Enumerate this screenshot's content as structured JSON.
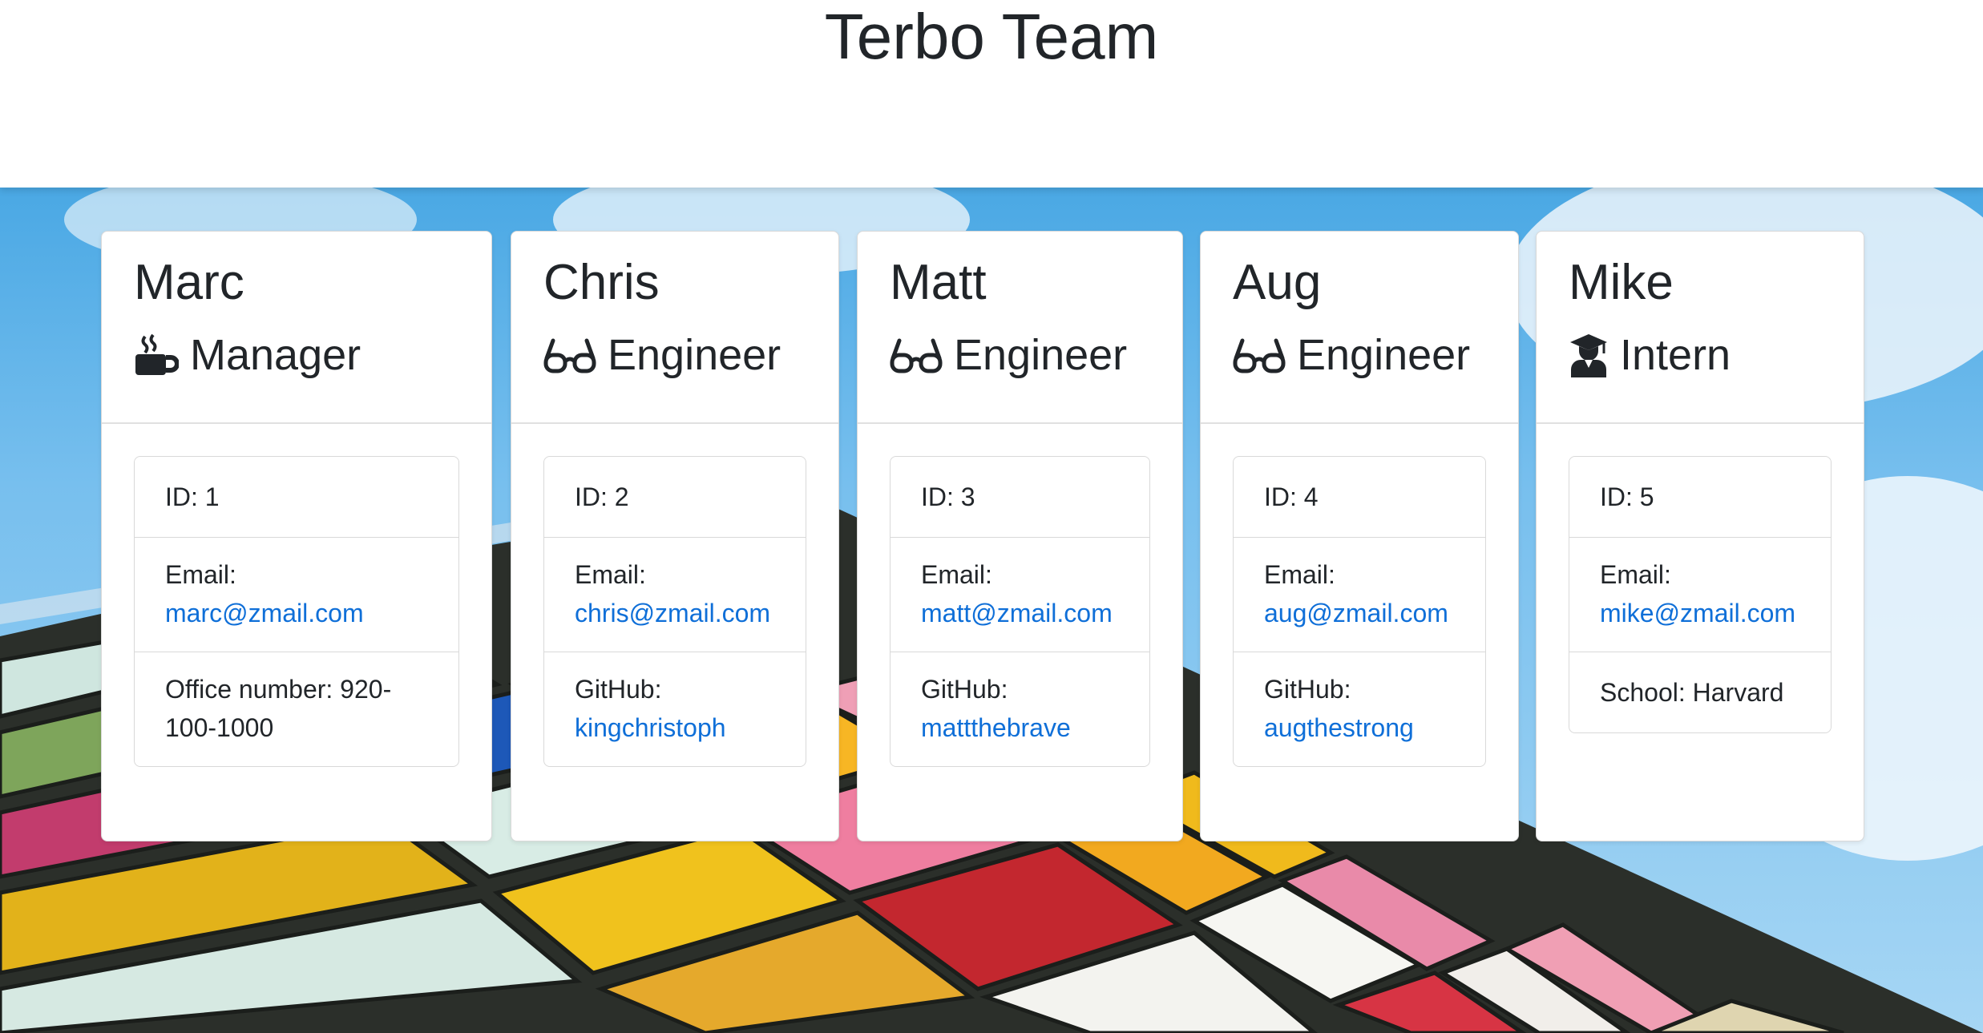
{
  "page_title": "Terbo Team",
  "team": [
    {
      "name": "Marc",
      "role": "Manager",
      "role_icon": "coffee-icon",
      "id_text": "ID: 1",
      "email_label": "Email:",
      "email": "marc@zmail.com",
      "extra_text": "Office number: 920-100-1000"
    },
    {
      "name": "Chris",
      "role": "Engineer",
      "role_icon": "glasses-icon",
      "id_text": "ID: 2",
      "email_label": "Email:",
      "email": "chris@zmail.com",
      "extra_label": "GitHub:",
      "extra_link": "kingchristoph"
    },
    {
      "name": "Matt",
      "role": "Engineer",
      "role_icon": "glasses-icon",
      "id_text": "ID: 3",
      "email_label": "Email:",
      "email": "matt@zmail.com",
      "extra_label": "GitHub:",
      "extra_link": "mattthebrave"
    },
    {
      "name": "Aug",
      "role": "Engineer",
      "role_icon": "glasses-icon",
      "id_text": "ID: 4",
      "email_label": "Email:",
      "email": "aug@zmail.com",
      "extra_label": "GitHub:",
      "extra_link": "augthestrong"
    },
    {
      "name": "Mike",
      "role": "Intern",
      "role_icon": "graduate-icon",
      "id_text": "ID: 5",
      "email_label": "Email:",
      "email": "mike@zmail.com",
      "extra_text": "School: Harvard"
    }
  ],
  "colors": {
    "link": "#0f6fd8",
    "text": "#212529",
    "sky": "#77bfee"
  }
}
